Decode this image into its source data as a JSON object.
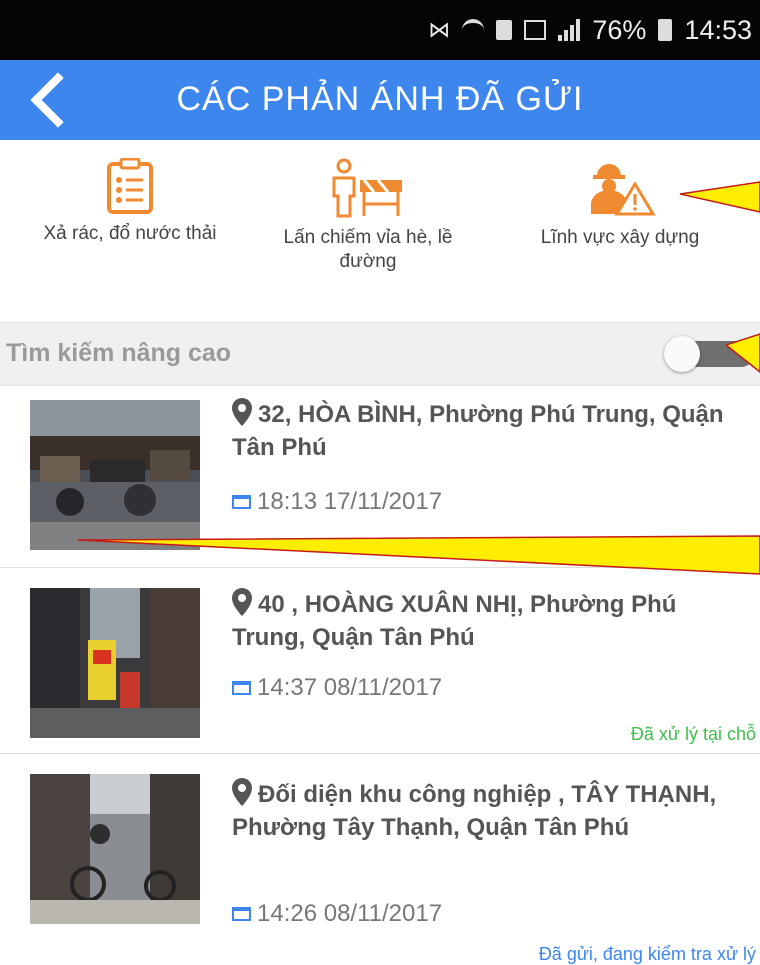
{
  "status_bar": {
    "battery": "76%",
    "time": "14:53"
  },
  "app_bar": {
    "title": "CÁC PHẢN ÁNH ĐÃ GỬI"
  },
  "categories": [
    {
      "label": "Xả rác, đổ nước thải",
      "icon": "clipboard-list-icon"
    },
    {
      "label": "Lấn chiếm vỉa hè, lề đường",
      "icon": "sidewalk-vendor-icon"
    },
    {
      "label": "Lĩnh vực xây dựng",
      "icon": "construction-worker-icon"
    }
  ],
  "search": {
    "label": "Tìm kiếm nâng cao",
    "toggle_on": false
  },
  "reports": [
    {
      "address": "32, HÒA BÌNH, Phường Phú Trung, Quận Tân Phú",
      "datetime": "18:13 17/11/2017",
      "status": ""
    },
    {
      "address": "40 , HOÀNG XUÂN NHỊ, Phường Phú Trung, Quận Tân Phú",
      "datetime": "14:37 08/11/2017",
      "status": "Đã xử lý tại chỗ"
    },
    {
      "address": "Đối diện khu công nghiệp , TÂY THẠNH, Phường Tây Thạnh, Quận Tân Phú",
      "datetime": "14:26 08/11/2017",
      "status": "Đã gửi, đang kiểm tra xử lý"
    }
  ],
  "colors": {
    "app_bar": "#3d86ed",
    "category_icon": "#f08a30",
    "status_done": "#3fbf4c",
    "status_pending": "#3d86ed",
    "annotation_arrow": "#ffee00"
  }
}
